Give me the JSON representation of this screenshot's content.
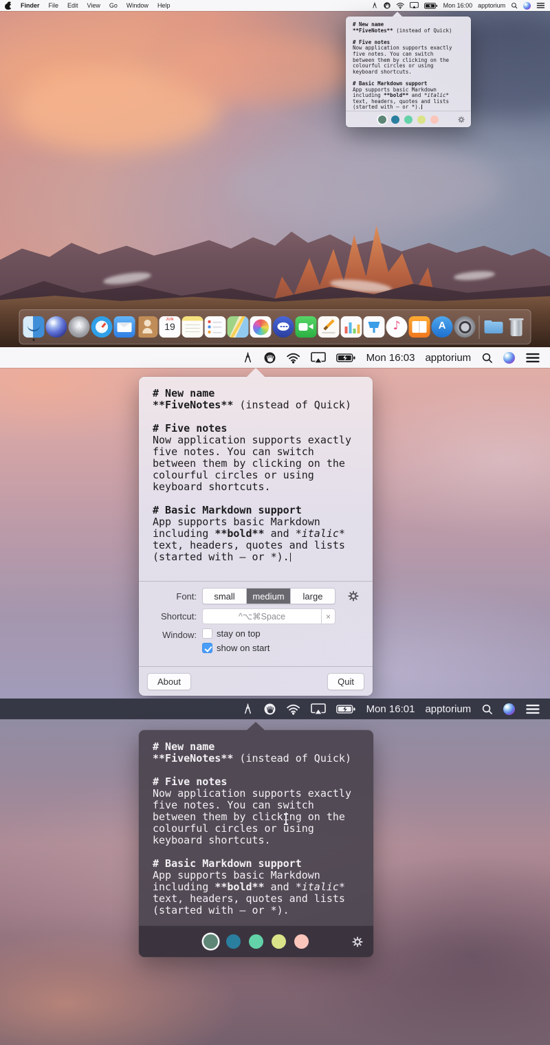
{
  "menubar": {
    "app_name": "Finder",
    "menus": [
      "File",
      "Edit",
      "View",
      "Go",
      "Window",
      "Help"
    ],
    "username": "apptorium",
    "time_desktop": "Mon 16:00",
    "time_light": "Mon 16:03",
    "time_dark": "Mon 16:01"
  },
  "note": {
    "sec1_title": "# New name",
    "sec1_bold": "**FiveNotes**",
    "sec1_rest": " (instead of Quick)",
    "sec2_title": "# Five notes",
    "sec2_lines": [
      "Now application supports exactly",
      "five notes. You can switch",
      "between them by clicking on the",
      "colourful circles or using",
      "keyboard shortcuts."
    ],
    "sec3_title": "# Basic Markdown support",
    "sec3_line1": "App supports basic Markdown",
    "sec3_line2_pre": "including ",
    "sec3_line2_bold": "**bold**",
    "sec3_line2_mid": " and ",
    "sec3_line2_italic": "*italic*",
    "sec3_line3": "text, headers, quotes and lists",
    "sec3_line4": "(started with – or *)."
  },
  "settings": {
    "font_label": "Font:",
    "font_small": "small",
    "font_medium": "medium",
    "font_large": "large",
    "shortcut_label": "Shortcut:",
    "shortcut_value": "^⌥⌘Space",
    "shortcut_clear": "×",
    "window_label": "Window:",
    "stay_on_top": "stay on top",
    "show_on_start": "show on start",
    "about": "About",
    "quit": "Quit"
  },
  "palette": {
    "colors": [
      "#5E8677",
      "#2A7F9F",
      "#63D2A8",
      "#DBE388",
      "#FAC6BC"
    ],
    "selected_index": 0
  },
  "dock": {
    "items": [
      "finder",
      "siri",
      "launchpad",
      "safari",
      "mail",
      "contacts",
      "calendar",
      "notes",
      "reminders",
      "maps",
      "photos",
      "messages",
      "facetime",
      "pages",
      "numbers",
      "keynote",
      "itunes",
      "ibooks",
      "app-store",
      "system-preferences",
      "downloads",
      "trash"
    ],
    "calendar_month": "JUN",
    "calendar_day": "19"
  },
  "status_icons": [
    "compass-divider",
    "fivenotes-hand",
    "wifi",
    "airplay",
    "battery-charging",
    "spotlight-search",
    "siri",
    "notification-center"
  ],
  "colors": {
    "accent_blue": "#4A9DF8",
    "light_popover": "#E6E3EC",
    "dark_popover": "#4D4651"
  }
}
